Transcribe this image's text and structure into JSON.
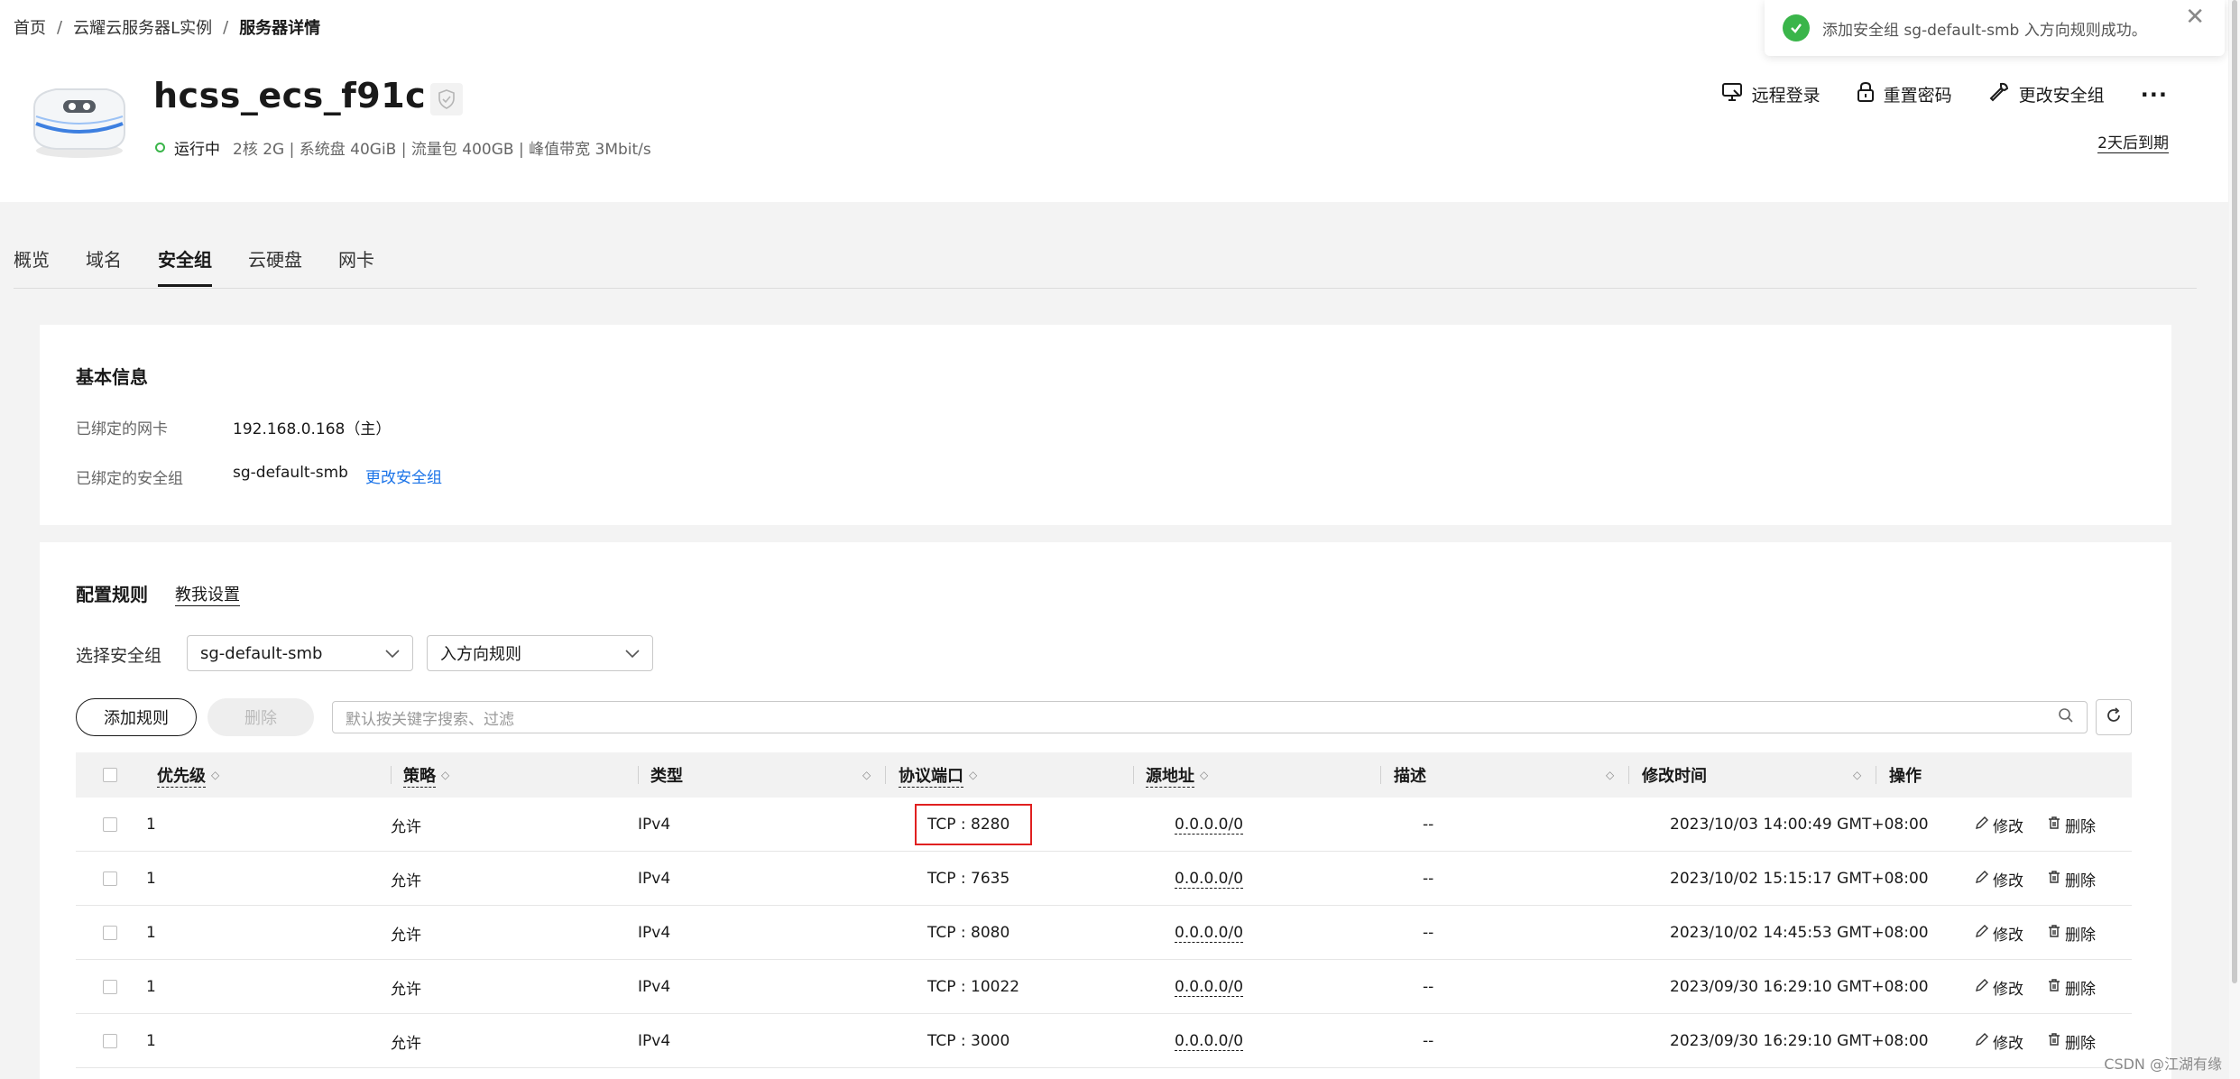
{
  "breadcrumb": {
    "items": [
      "首页",
      "云耀云服务器L实例",
      "服务器详情"
    ],
    "separator": "/"
  },
  "server": {
    "name": "hcss_ecs_f91c",
    "status": "运行中",
    "specs": "2核  2G | 系统盘 40GiB | 流量包 400GB | 峰值带宽 3Mbit/s",
    "expiry": "2天后到期"
  },
  "actions": {
    "remote_login": "远程登录",
    "reset_password": "重置密码",
    "change_sg": "更改安全组",
    "more": "···"
  },
  "toast": {
    "message": "添加安全组 sg-default-smb 入方向规则成功。",
    "close": "✕"
  },
  "tabs": [
    {
      "label": "概览",
      "active": false
    },
    {
      "label": "域名",
      "active": false
    },
    {
      "label": "安全组",
      "active": true
    },
    {
      "label": "云硬盘",
      "active": false
    },
    {
      "label": "网卡",
      "active": false
    }
  ],
  "basic_info": {
    "title": "基本信息",
    "nic_label": "已绑定的网卡",
    "nic_value": "192.168.0.168（主）",
    "sg_label": "已绑定的安全组",
    "sg_value": "sg-default-smb",
    "sg_change_link": "更改安全组"
  },
  "rules": {
    "title": "配置规则",
    "guide_link": "教我设置",
    "select_label": "选择安全组",
    "selected_sg": "sg-default-smb",
    "direction": "入方向规则",
    "add_button": "添加规则",
    "delete_button": "删除",
    "search_placeholder": "默认按关键字搜索、过滤",
    "columns": [
      "优先级",
      "策略",
      "类型",
      "协议端口",
      "源地址",
      "描述",
      "修改时间",
      "操作"
    ],
    "rows": [
      {
        "priority": "1",
        "policy": "允许",
        "type": "IPv4",
        "port": "TCP : 8280",
        "source": "0.0.0.0/0",
        "desc": "--",
        "time": "2023/10/03 14:00:49 GMT+08:00"
      },
      {
        "priority": "1",
        "policy": "允许",
        "type": "IPv4",
        "port": "TCP : 7635",
        "source": "0.0.0.0/0",
        "desc": "--",
        "time": "2023/10/02 15:15:17 GMT+08:00"
      },
      {
        "priority": "1",
        "policy": "允许",
        "type": "IPv4",
        "port": "TCP : 8080",
        "source": "0.0.0.0/0",
        "desc": "--",
        "time": "2023/10/02 14:45:53 GMT+08:00"
      },
      {
        "priority": "1",
        "policy": "允许",
        "type": "IPv4",
        "port": "TCP : 10022",
        "source": "0.0.0.0/0",
        "desc": "--",
        "time": "2023/09/30 16:29:10 GMT+08:00"
      },
      {
        "priority": "1",
        "policy": "允许",
        "type": "IPv4",
        "port": "TCP : 3000",
        "source": "0.0.0.0/0",
        "desc": "--",
        "time": "2023/09/30 16:29:10 GMT+08:00"
      }
    ],
    "edit_label": "修改",
    "delete_label": "删除"
  },
  "watermark": "CSDN @江湖有缘",
  "colors": {
    "status_green": "#3ab54a",
    "link_blue": "#1a73e8",
    "highlight_red": "#e02020"
  }
}
